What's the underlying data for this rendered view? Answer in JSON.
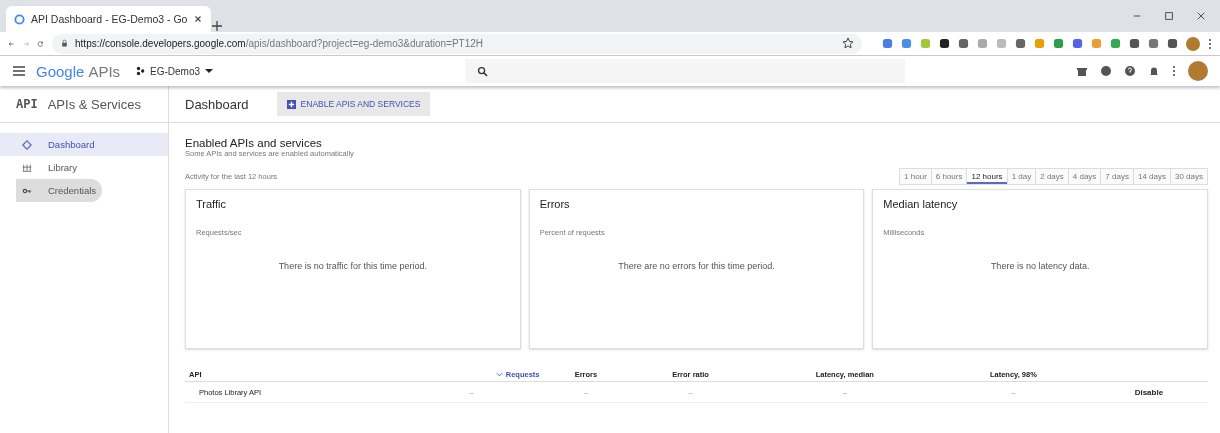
{
  "browser": {
    "tab_title": "API Dashboard - EG-Demo3 - Go",
    "url_host": "https://console.developers.google.com",
    "url_path": "/apis/dashboard?project=eg-demo3&duration=PT12H"
  },
  "header": {
    "logo_brand": "Google",
    "logo_product": "APIs",
    "project": "EG-Demo3"
  },
  "sidebar": {
    "badge": "API",
    "title": "APIs & Services",
    "items": [
      {
        "label": "Dashboard",
        "selected": true,
        "hovered": false
      },
      {
        "label": "Library",
        "selected": false,
        "hovered": false
      },
      {
        "label": "Credentials",
        "selected": false,
        "hovered": true
      }
    ]
  },
  "page": {
    "title": "Dashboard",
    "action": "ENABLE APIS AND SERVICES"
  },
  "section": {
    "title": "Enabled APIs and services",
    "subtitle": "Some APIs and services are enabled automatically",
    "activity": "Activity for the last 12 hours"
  },
  "ranges": [
    {
      "label": "1 hour",
      "selected": false
    },
    {
      "label": "6 hours",
      "selected": false
    },
    {
      "label": "12 hours",
      "selected": true
    },
    {
      "label": "1 day",
      "selected": false
    },
    {
      "label": "2 days",
      "selected": false
    },
    {
      "label": "4 days",
      "selected": false
    },
    {
      "label": "7 days",
      "selected": false
    },
    {
      "label": "14 days",
      "selected": false
    },
    {
      "label": "30 days",
      "selected": false
    }
  ],
  "cards": [
    {
      "title": "Traffic",
      "subtitle": "Requests/sec",
      "message": "There is no traffic for this time period."
    },
    {
      "title": "Errors",
      "subtitle": "Percent of requests",
      "message": "There are no errors for this time period."
    },
    {
      "title": "Median latency",
      "subtitle": "Milliseconds",
      "message": "There is no latency data."
    }
  ],
  "table": {
    "columns": [
      {
        "label": "API",
        "sorted": false
      },
      {
        "label": "Requests",
        "sorted": true
      },
      {
        "label": "Errors",
        "sorted": false
      },
      {
        "label": "Error ratio",
        "sorted": false
      },
      {
        "label": "Latency, median",
        "sorted": false
      },
      {
        "label": "Latency, 98%",
        "sorted": false
      }
    ],
    "rows": [
      {
        "cells": [
          "Photos Library API",
          "–",
          "–",
          "–",
          "–",
          "–"
        ],
        "action": "Disable"
      }
    ]
  }
}
